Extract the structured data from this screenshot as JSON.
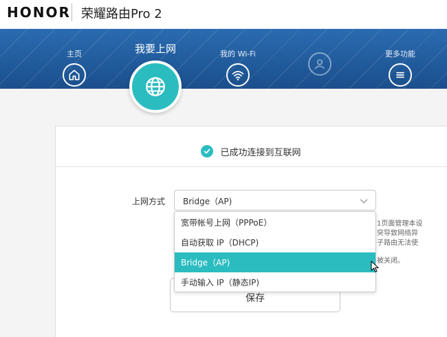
{
  "brand": {
    "logo": "HONOR",
    "product_title": "荣耀路由Pro 2"
  },
  "nav": {
    "items": [
      {
        "label": "主页",
        "icon": "home-icon"
      },
      {
        "label": "我要上网",
        "icon": "globe-icon",
        "active": true
      },
      {
        "label": "我的 Wi-Fi",
        "icon": "wifi-icon"
      },
      {
        "label": "",
        "icon": "user-icon",
        "disabled": true
      },
      {
        "label": "更多功能",
        "icon": "menu-icon"
      }
    ]
  },
  "status": {
    "text": "已成功连接到互联网",
    "icon": "check-circle-icon"
  },
  "form": {
    "connection_label": "上网方式",
    "selected_value": "Bridge（AP)",
    "options": [
      "宽带帐号上网（PPPoE）",
      "自动获取 IP（DHCP)",
      "Bridge（AP)",
      "手动输入 IP（静态IP)"
    ],
    "selected_index": 2
  },
  "hidden_notes": {
    "line1": "1页面管理本设",
    "line2": "突导致网络异",
    "line3": "子路由无法使",
    "line4": "被关闭。"
  },
  "actions": {
    "save_label": "保存"
  },
  "colors": {
    "accent": "#2bbcc0",
    "nav_band": "#1f5a9a"
  }
}
